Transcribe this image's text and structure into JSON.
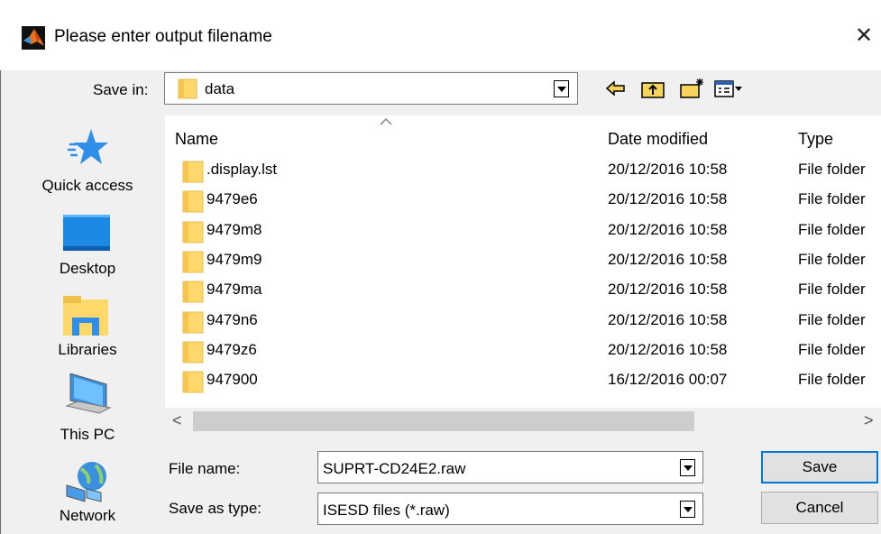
{
  "window": {
    "title": "Please enter output filename",
    "close_glyph": "✕"
  },
  "toolbar": {
    "save_in_label": "Save in:",
    "save_in_value": "data",
    "icons": [
      "back-arrow-icon",
      "up-folder-icon",
      "new-folder-icon",
      "view-menu-icon"
    ]
  },
  "places": [
    {
      "label": "Quick access",
      "icon": "star-icon"
    },
    {
      "label": "Desktop",
      "icon": "desktop-icon"
    },
    {
      "label": "Libraries",
      "icon": "libraries-icon"
    },
    {
      "label": "This PC",
      "icon": "computer-icon"
    },
    {
      "label": "Network",
      "icon": "network-icon"
    }
  ],
  "file_list": {
    "columns": {
      "name": "Name",
      "date": "Date modified",
      "type": "Type"
    },
    "rows": [
      {
        "name": ".display.lst",
        "date": "20/12/2016 10:58",
        "type": "File folder"
      },
      {
        "name": "9479e6",
        "date": "20/12/2016 10:58",
        "type": "File folder"
      },
      {
        "name": "9479m8",
        "date": "20/12/2016 10:58",
        "type": "File folder"
      },
      {
        "name": "9479m9",
        "date": "20/12/2016 10:58",
        "type": "File folder"
      },
      {
        "name": "9479ma",
        "date": "20/12/2016 10:58",
        "type": "File folder"
      },
      {
        "name": "9479n6",
        "date": "20/12/2016 10:58",
        "type": "File folder"
      },
      {
        "name": "9479z6",
        "date": "20/12/2016 10:58",
        "type": "File folder"
      },
      {
        "name": "947900",
        "date": "16/12/2016 00:07",
        "type": "File folder"
      }
    ]
  },
  "scroll": {
    "left_glyph": "<",
    "right_glyph": ">"
  },
  "form": {
    "file_name_label": "File name:",
    "file_name_value": "SUPRT-CD24E2.raw",
    "save_type_label": "Save as type:",
    "save_type_value": "ISESD files (*.raw)"
  },
  "buttons": {
    "save": "Save",
    "cancel": "Cancel"
  },
  "colors": {
    "folder": "#ffd86b",
    "accent": "#0078d7",
    "star": "#2f8fe8"
  }
}
